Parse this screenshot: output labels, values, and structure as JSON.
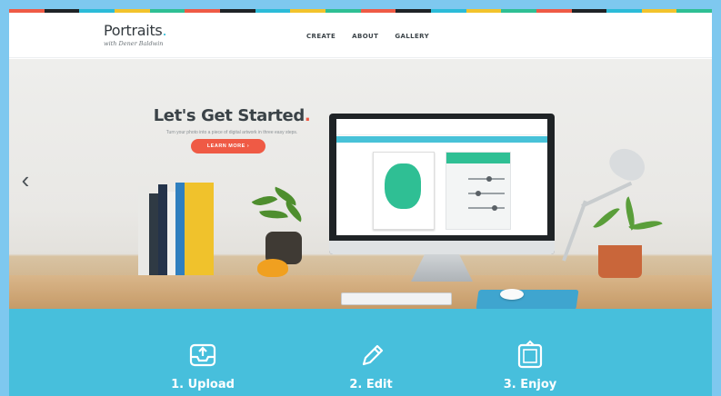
{
  "header": {
    "logo_title": "Portraits",
    "logo_dot": ".",
    "logo_tagline": "with Dener Baldwin",
    "nav": [
      {
        "label": "CREATE"
      },
      {
        "label": "ABOUT"
      },
      {
        "label": "GALLERY"
      }
    ]
  },
  "hero": {
    "title": "Let's Get Started",
    "title_dot": ".",
    "subtitle": "Turn your photo into a piece of digital artwork in three easy steps.",
    "cta_label": "LEARN MORE",
    "cta_arrow": "›",
    "prev_arrow": "‹",
    "next_arrow": "›"
  },
  "steps": [
    {
      "label": "1. Upload",
      "icon": "upload-icon"
    },
    {
      "label": "2. Edit",
      "icon": "pencil-icon"
    },
    {
      "label": "3. Enjoy",
      "icon": "frame-icon"
    }
  ],
  "colors": {
    "accent": "#ef5a45",
    "steps_band": "#47bfdc",
    "frame_bg": "#7ec8ef",
    "stripe": [
      "#ef5a45",
      "#1f2326",
      "#2bbbd8",
      "#f2c32c",
      "#2fbf94",
      "#ef5a45",
      "#1f2326",
      "#2bbbd8",
      "#f2c32c",
      "#2fbf94",
      "#ef5a45",
      "#1f2326",
      "#2bbbd8",
      "#f2c32c",
      "#2fbf94",
      "#ef5a45",
      "#1f2326",
      "#2bbbd8",
      "#f2c32c",
      "#2fbf94"
    ]
  }
}
